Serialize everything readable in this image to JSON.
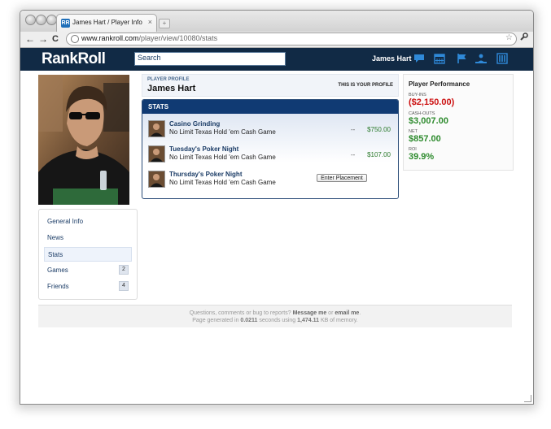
{
  "browser": {
    "tab_title": "James Hart / Player Info / Ra",
    "tab_favicon": "RR",
    "url_host": "www.rankroll.com",
    "url_path": "/player/view/10080/stats",
    "back_icon": "←",
    "forward_icon": "→",
    "reload_icon": "C",
    "star_icon": "☆",
    "close_icon": "×",
    "newtab_icon": "+"
  },
  "header": {
    "logo": "RankRoll",
    "search_placeholder": "Search",
    "user_name": "James Hart",
    "icons": [
      "chat-icon",
      "calendar-icon",
      "flag-icon",
      "people-icon",
      "stats-icon"
    ],
    "accent": "#2f89d8"
  },
  "sidebar": {
    "items": [
      {
        "label": "General Info",
        "badge": ""
      },
      {
        "label": "News",
        "badge": ""
      },
      {
        "label": "Stats",
        "badge": ""
      },
      {
        "label": "Games",
        "badge": "2"
      },
      {
        "label": "Friends",
        "badge": "4"
      }
    ],
    "active_index": 2
  },
  "profile": {
    "label": "PLAYER PROFILE",
    "name": "James Hart",
    "own_note": "THIS IS YOUR PROFILE"
  },
  "stats": {
    "title": "STATS",
    "games": [
      {
        "title": "Casino Grinding",
        "type": "No Limit Texas Hold 'em Cash Game",
        "dash": "--",
        "amount": "$750.00"
      },
      {
        "title": "Tuesday's Poker Night",
        "type": "No Limit Texas Hold 'em Cash Game",
        "dash": "--",
        "amount": "$107.00"
      },
      {
        "title": "Thursday's Poker Night",
        "type": "No Limit Texas Hold 'em Cash Game",
        "button": "Enter Placement"
      }
    ]
  },
  "performance": {
    "title": "Player Performance",
    "buyins_label": "BUY-INS",
    "buyins": "($2,150.00)",
    "cashouts_label": "CASH-OUTS",
    "cashouts": "$3,007.00",
    "net_label": "NET",
    "net": "$857.00",
    "roi_label": "ROI",
    "roi": "39.9%",
    "negative_color": "#cc1111",
    "positive_color": "#2e8b2e"
  },
  "footer": {
    "line1_pre": "Questions, comments or bug to reports?",
    "line1_link1": "Message me",
    "line1_mid": "or",
    "line1_link2": "email me",
    "line1_end": ".",
    "line2_pre": "Page generated in",
    "line2_time": "0.0211",
    "line2_mid": "seconds using",
    "line2_mem": "1,474.11",
    "line2_end": "KB of memory."
  }
}
